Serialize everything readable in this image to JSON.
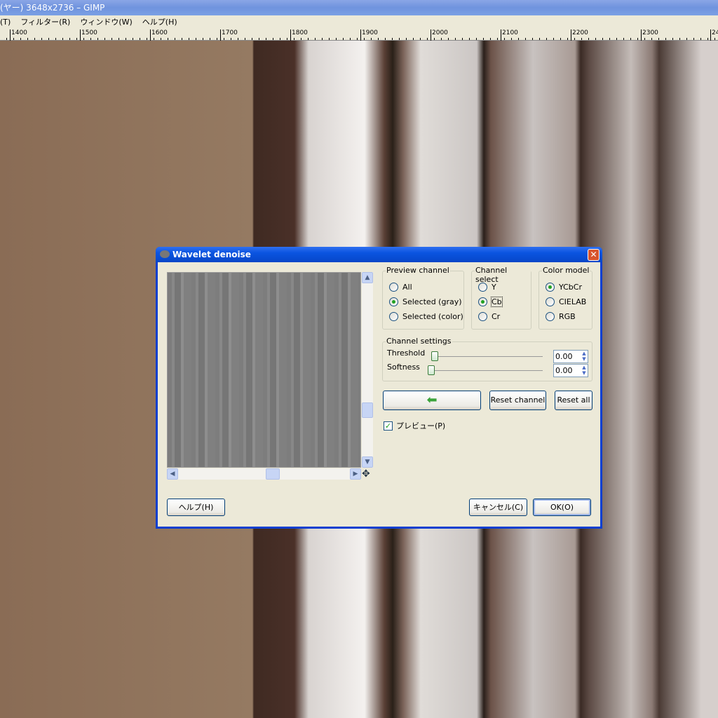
{
  "window": {
    "title": "(ヤー) 3648x2736 – GIMP"
  },
  "menubar": [
    "(T)",
    "フィルター(R)",
    "ウィンドウ(W)",
    "ヘルプ(H)"
  ],
  "ruler": [
    "1400",
    "1500",
    "1600",
    "1700",
    "1800",
    "1900",
    "2000",
    "2100",
    "2200",
    "2300",
    "24"
  ],
  "dialog": {
    "title": "Wavelet denoise",
    "preview_channel": {
      "label": "Preview channel",
      "options": [
        "All",
        "Selected (gray)",
        "Selected (color)"
      ],
      "selected": 1
    },
    "channel_select": {
      "label": "Channel select",
      "options": [
        "Y",
        "Cb",
        "Cr"
      ],
      "selected": 1
    },
    "color_model": {
      "label": "Color model",
      "options": [
        "YCbCr",
        "CIELAB",
        "RGB"
      ],
      "selected": 0
    },
    "channel_settings": {
      "label": "Channel settings",
      "threshold_label": "Threshold",
      "threshold": "0.00",
      "softness_label": "Softness",
      "softness": "0.00"
    },
    "reset_channel": "Reset channel",
    "reset_all": "Reset all",
    "preview_check": "プレビュー(P)",
    "help": "ヘルプ(H)",
    "cancel": "キャンセル(C)",
    "ok": "OK(O)"
  }
}
